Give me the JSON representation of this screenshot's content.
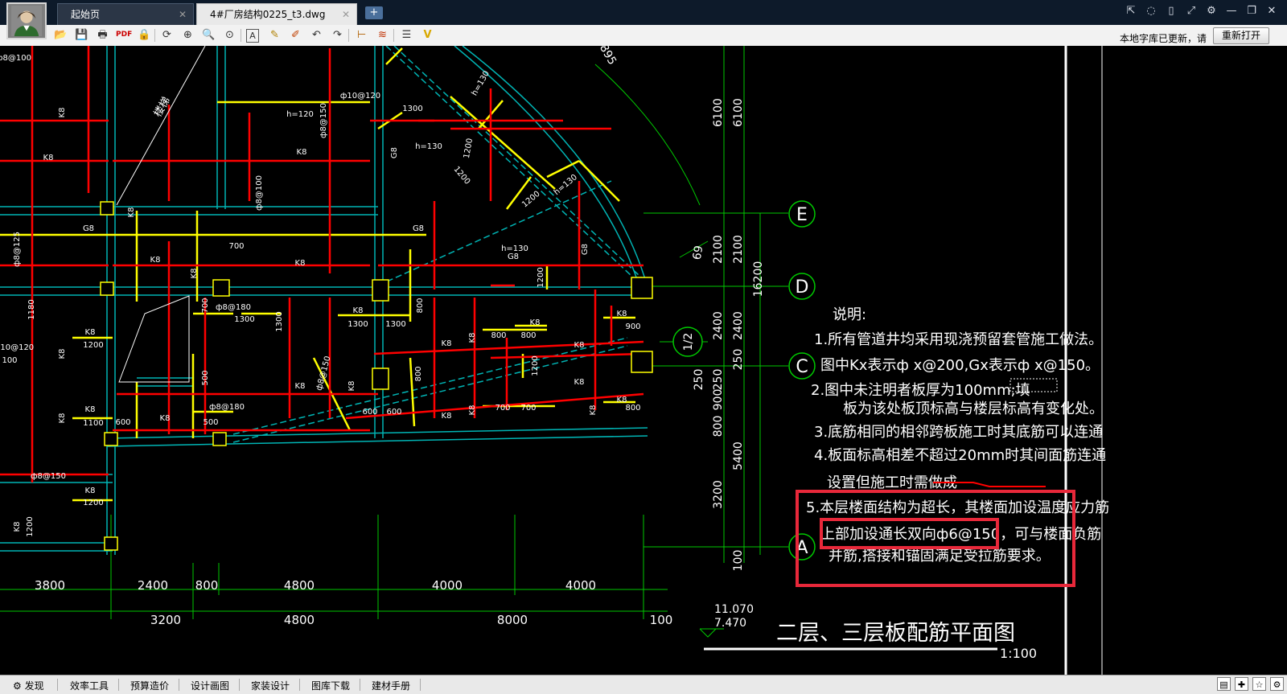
{
  "tabs": [
    {
      "label": "起始页"
    },
    {
      "label": "4#厂房结构0225_t3.dwg"
    }
  ],
  "toolbar": {
    "notice": "本地字库已更新，请",
    "reopen_label": "重新打开"
  },
  "drawing": {
    "axes": [
      "E",
      "D",
      "C",
      "A"
    ],
    "axis_bottom": "1/2",
    "left_dims": [
      "6100",
      "2100",
      "2400",
      "250",
      "900",
      "800",
      "5400",
      "3200",
      "100"
    ],
    "right_dims": [
      "6100",
      "2100",
      "2400",
      "250",
      "900",
      "800"
    ],
    "total_dim": "16200",
    "bottom_dims_row1": [
      "3800",
      "2400",
      "800",
      "4800",
      "4000",
      "4000"
    ],
    "bottom_dims_row2": [
      "3200",
      "4800",
      "8000",
      "100"
    ],
    "elev_top": "11.070",
    "elev_bottom": "7.470",
    "drawing_title": "二层、三层板配筋平面图",
    "scale": "1:100",
    "notes": [
      "说明:",
      "1.所有管道井均采用现浇预留套管施工做法。",
      "图中Kx表示ф x@200,Gx表示ф x@150。",
      "2.图中未注明者板厚为100mm;填",
      "板为该处板顶标高与楼层标高有变化处。",
      "3.底筋相同的相邻跨板施工时其底筋可以连通",
      "4.板面标高相差不超过20mm时其间面筋连通",
      "设置但施工时需做成",
      "5.本层楼面结构为超长，其楼面加设温度应力筋",
      "上部加设通长双向ф6@150，可与楼面负筋",
      "并筋,搭接和锚固满足受拉筋要求。"
    ],
    "labels": {
      "k8": "K8",
      "g8": "G8",
      "h120": "h=120",
      "h130": "h=130",
      "stair": "楼梯",
      "r8100": "ф8@100",
      "r10120": "ф10@120",
      "r8150": "ф8@150",
      "r8180": "ф8@180",
      "r8125": "ф8@125",
      "d1300": "1300",
      "d1200": "1200",
      "d1100": "1100",
      "d700": "700",
      "d800": "800",
      "d600": "600",
      "d500": "500",
      "d900": "900",
      "d1180": "1180",
      "d100": "100",
      "d895": "895",
      "d69": "69"
    }
  },
  "statusbar": {
    "items": [
      "发现",
      "效率工具",
      "预算造价",
      "设计画图",
      "家装设计",
      "图库下载",
      "建材手册"
    ]
  },
  "colors": {
    "accent_highlight": "#e8283a",
    "cad_green": "#00c800",
    "cad_yellow": "#ffff00",
    "cad_red": "#ff0000",
    "cad_cyan": "#00b4b4"
  }
}
